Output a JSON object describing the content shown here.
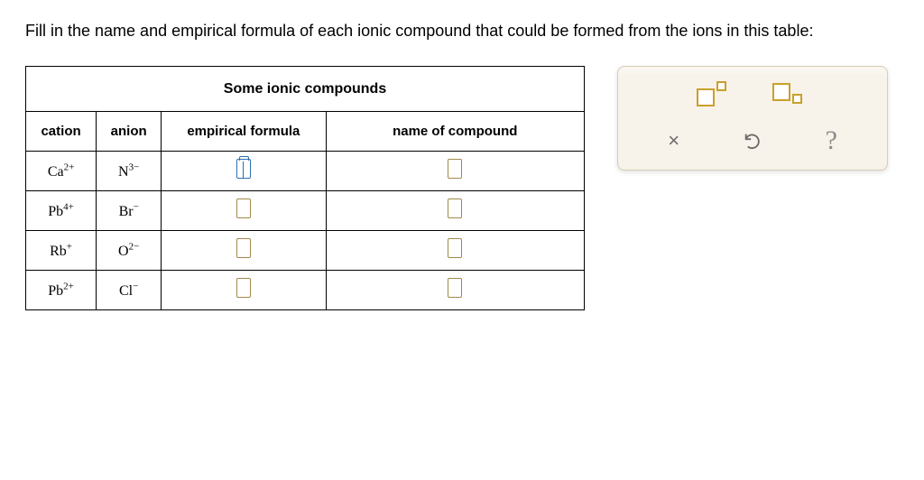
{
  "question": "Fill in the name and empirical formula of each ionic compound that could be formed from the ions in this table:",
  "table": {
    "title": "Some ionic compounds",
    "headers": {
      "cation": "cation",
      "anion": "anion",
      "formula": "empirical formula",
      "name": "name of compound"
    }
  },
  "chart_data": {
    "type": "table",
    "columns": [
      "cation",
      "anion",
      "empirical_formula",
      "name_of_compound"
    ],
    "rows": [
      {
        "cation_base": "Ca",
        "cation_charge": "2+",
        "anion_base": "N",
        "anion_charge": "3−",
        "empirical_formula": "",
        "name_of_compound": ""
      },
      {
        "cation_base": "Pb",
        "cation_charge": "4+",
        "anion_base": "Br",
        "anion_charge": "−",
        "empirical_formula": "",
        "name_of_compound": ""
      },
      {
        "cation_base": "Rb",
        "cation_charge": "+",
        "anion_base": "O",
        "anion_charge": "2−",
        "empirical_formula": "",
        "name_of_compound": ""
      },
      {
        "cation_base": "Pb",
        "cation_charge": "2+",
        "anion_base": "Cl",
        "anion_charge": "−",
        "empirical_formula": "",
        "name_of_compound": ""
      }
    ]
  },
  "tools": {
    "clear": "×",
    "help": "?"
  }
}
